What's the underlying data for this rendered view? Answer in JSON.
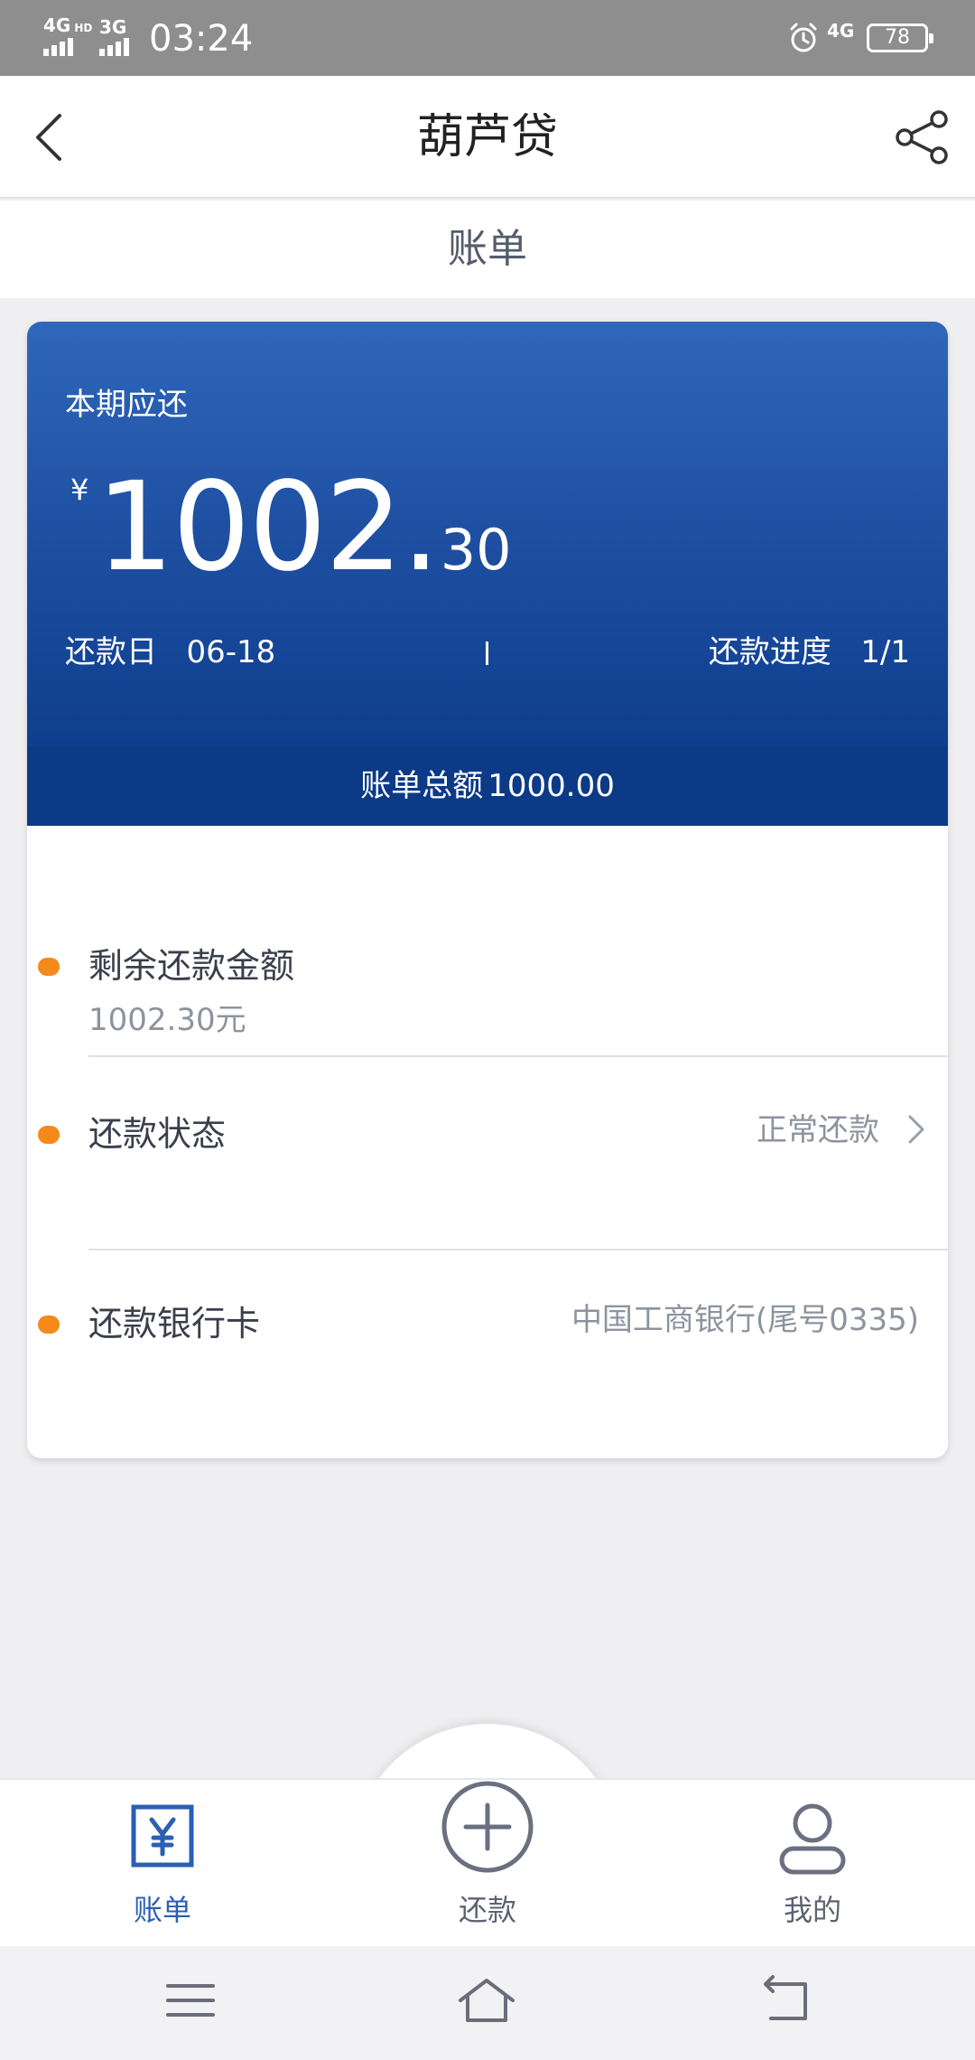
{
  "status_bar": {
    "sim1": "4G",
    "sim1_sup": "HD",
    "sim2": "3G",
    "time": "03:24",
    "data_net": "4G",
    "battery": "78"
  },
  "header": {
    "title": "葫芦贷"
  },
  "subheader": {
    "title": "账单"
  },
  "bill_card": {
    "due_label": "本期应还",
    "currency": "¥",
    "amount_int": "1002",
    "amount_dec": "30",
    "due_date_label": "还款日",
    "due_date": "06-18",
    "progress_label": "还款进度",
    "progress": "1/1",
    "total_label": "账单总额",
    "total": "1000.00"
  },
  "details": [
    {
      "label": "剩余还款金额",
      "value": "1002.30元"
    },
    {
      "label": "还款状态",
      "value": "正常还款"
    },
    {
      "label": "还款银行卡",
      "value": "中国工商银行(尾号0335)"
    }
  ],
  "tabbar": {
    "bill": "账单",
    "repay": "还款",
    "mine": "我的"
  },
  "colors": {
    "brand_blue": "#2a5fb4",
    "card_blue": "#1c4d9f",
    "accent_orange": "#f5891a"
  }
}
